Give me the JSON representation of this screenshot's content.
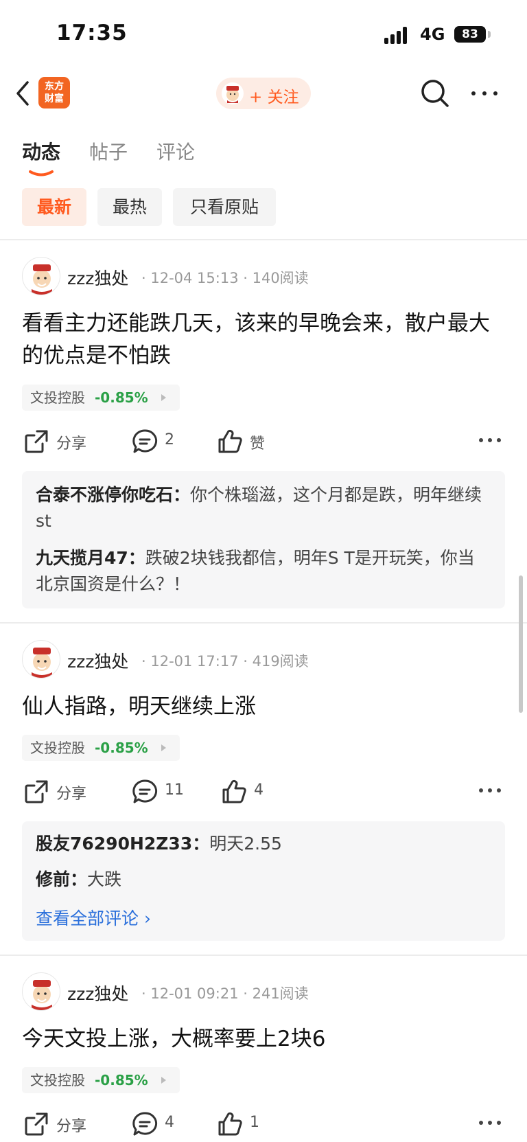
{
  "status_bar": {
    "time": "17:35",
    "network": "4G",
    "battery": "83"
  },
  "nav": {
    "logo_line1": "东方",
    "logo_line2": "财富",
    "follow_label": "+ 关注"
  },
  "tabs": [
    {
      "label": "动态",
      "active": true
    },
    {
      "label": "帖子",
      "active": false
    },
    {
      "label": "评论",
      "active": false
    }
  ],
  "filters": [
    {
      "label": "最新",
      "active": true
    },
    {
      "label": "最热",
      "active": false
    },
    {
      "label": "只看原贴",
      "active": false
    }
  ],
  "colors": {
    "accent": "#ff5a1f",
    "down_green": "#2aa046",
    "link_blue": "#2a6fdb"
  },
  "posts": [
    {
      "username": "zzz独处",
      "meta": "· 12-04 15:13 · 140阅读",
      "content": "看看主力还能跌几天，该来的早晚会来，散户最大的优点是不怕跌",
      "stock": {
        "name": "文投控股",
        "change": "-0.85%"
      },
      "share_label": "分享",
      "comment_count": "2",
      "like_label": "赞",
      "comments": [
        {
          "author": "合泰不涨停你吃石：",
          "text": "你个株瑙滋，这个月都是跌，明年继续st"
        },
        {
          "author": "九天揽月47：",
          "text": "跌破2块钱我都信，明年S T是开玩笑，你当北京国资是什么？！"
        }
      ]
    },
    {
      "username": "zzz独处",
      "meta": "· 12-01 17:17 · 419阅读",
      "content": "仙人指路，明天继续上涨",
      "stock": {
        "name": "文投控股",
        "change": "-0.85%"
      },
      "share_label": "分享",
      "comment_count": "11",
      "like_label": "4",
      "comments": [
        {
          "author": "股友76290H2Z33：",
          "text": "明天2.55"
        },
        {
          "author": "修前：",
          "text": "大跌"
        }
      ],
      "view_all": "查看全部评论 ›"
    },
    {
      "username": "zzz独处",
      "meta": "· 12-01 09:21 · 241阅读",
      "content": "今天文投上涨，大概率要上2块6",
      "stock": {
        "name": "文投控股",
        "change": "-0.85%"
      },
      "share_label": "分享",
      "comment_count": "4",
      "like_label": "1"
    }
  ]
}
